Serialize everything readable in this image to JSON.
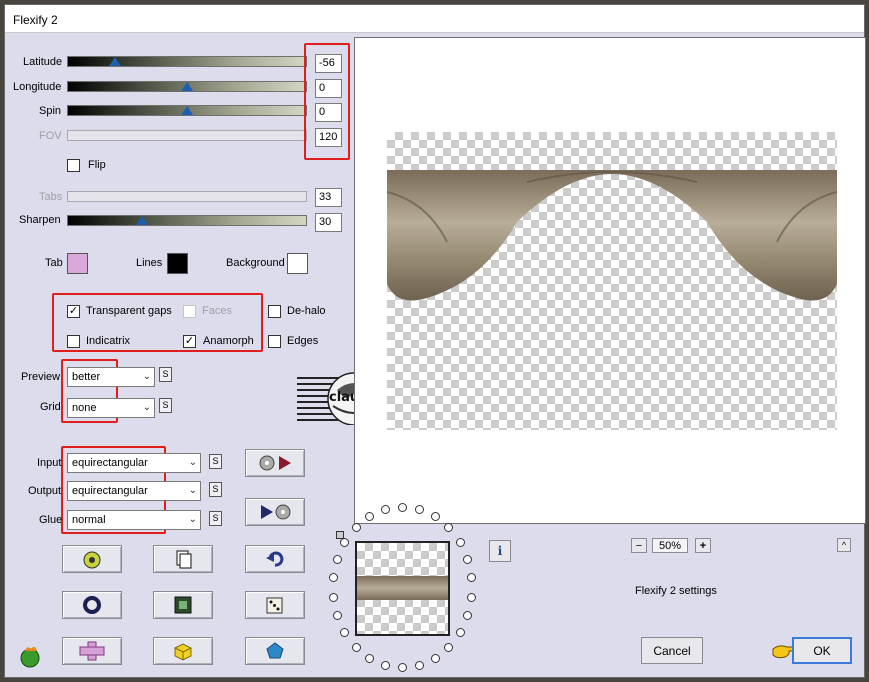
{
  "window": {
    "title": "Flexify 2"
  },
  "params": {
    "latitude": {
      "label": "Latitude",
      "value": "-56",
      "fraction": 0.18
    },
    "longitude": {
      "label": "Longitude",
      "value": "0",
      "fraction": 0.5
    },
    "spin": {
      "label": "Spin",
      "value": "0",
      "fraction": 0.5
    },
    "fov": {
      "label": "FOV",
      "value": "120"
    },
    "flip": {
      "label": "Flip"
    },
    "tabs": {
      "label": "Tabs",
      "value": "33"
    },
    "sharpen": {
      "label": "Sharpen",
      "value": "30",
      "fraction": 0.3
    }
  },
  "colors": {
    "tab": {
      "label": "Tab",
      "color": "#d9a8dd"
    },
    "lines": {
      "label": "Lines",
      "color": "#000000"
    },
    "background": {
      "label": "Background",
      "color": "#ffffff"
    }
  },
  "options": {
    "transparent_gaps": {
      "label": "Transparent gaps",
      "checked": true
    },
    "faces": {
      "label": "Faces",
      "checked": false
    },
    "de_halo": {
      "label": "De-halo",
      "checked": false
    },
    "indicatrix": {
      "label": "Indicatrix",
      "checked": false
    },
    "anamorph": {
      "label": "Anamorph",
      "checked": true
    },
    "edges": {
      "label": "Edges",
      "checked": false
    }
  },
  "selects": {
    "preview": {
      "label": "Preview",
      "value": "better"
    },
    "grid": {
      "label": "Grid",
      "value": "none"
    },
    "input": {
      "label": "Input",
      "value": "equirectangular"
    },
    "output": {
      "label": "Output",
      "value": "equirectangular"
    },
    "glue": {
      "label": "Glue",
      "value": "normal"
    }
  },
  "small_button": "S",
  "watermark": "claudia",
  "zoom": {
    "minus": "−",
    "value": "50%",
    "plus": "+"
  },
  "settings_label": "Flexify 2 settings",
  "info_button": "i",
  "scroll_up": "^",
  "buttons": {
    "cancel": "Cancel",
    "ok": "OK"
  }
}
